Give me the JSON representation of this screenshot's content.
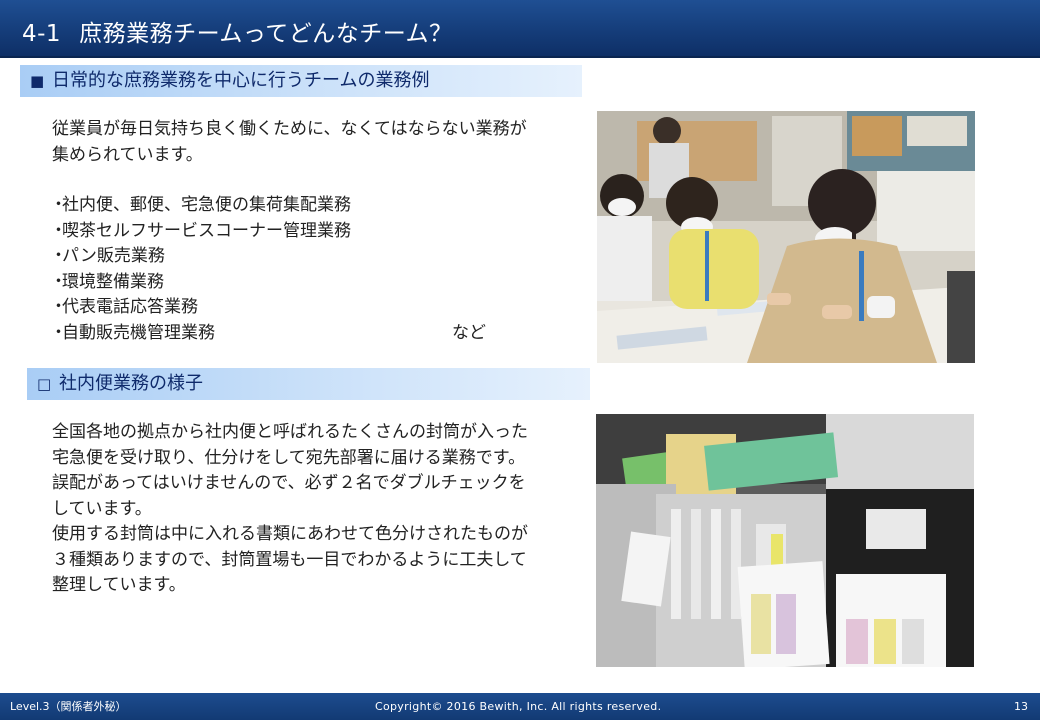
{
  "header": {
    "number": "4-1",
    "title": "庶務業務チームってどんなチーム？"
  },
  "section1": {
    "marker": "■",
    "heading": "日常的な庶務業務を中心に行うチームの業務例",
    "intro_line1": "従業員が毎日気持ち良く働くために、なくてはならない業務が",
    "intro_line2": "集められています。",
    "items": [
      "社内便、郵便、宅急便の集荷集配業務",
      "喫茶セルフサービスコーナー管理業務",
      "パン販売業務",
      "環境整備業務",
      "代表電話応答業務",
      "自動販売機管理業務"
    ],
    "item_bullet": "・",
    "etc": "など"
  },
  "section2": {
    "marker": "□",
    "heading": "社内便業務の様子",
    "lines": [
      "全国各地の拠点から社内便と呼ばれるたくさんの封筒が入った",
      "宅急便を受け取り、仕分けをして宛先部署に届ける業務です。",
      "誤配があってはいけませんので、必ず２名でダブルチェックを",
      "しています。",
      "使用する封筒は中に入れる書類にあわせて色分けされたものが",
      "３種類ありますので、封筒置場も一目でわかるように工夫して",
      "整理しています。"
    ]
  },
  "footer": {
    "level": "Level.3（関係者外秘）",
    "copyright": "Copyright© 2016 Bewith, Inc. All rights reserved.",
    "page": "13"
  }
}
